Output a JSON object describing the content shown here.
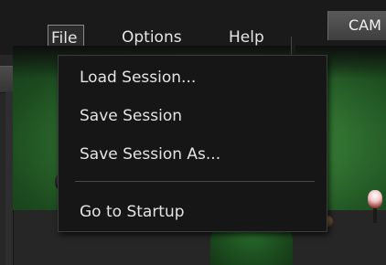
{
  "menubar": {
    "file": "File",
    "options": "Options",
    "help": "Help"
  },
  "tabs": {
    "cam": "CAM"
  },
  "file_menu": {
    "items": [
      {
        "label": "Load Session..."
      },
      {
        "label": "Save Session"
      },
      {
        "label": "Save Session As..."
      },
      {
        "label": "Go to Startup"
      }
    ]
  },
  "colors": {
    "menu_background": "#161616",
    "menu_text": "#e4e4e4",
    "active_menu_border": "#8a8a8a",
    "table_felt": "#2f6f2f"
  }
}
